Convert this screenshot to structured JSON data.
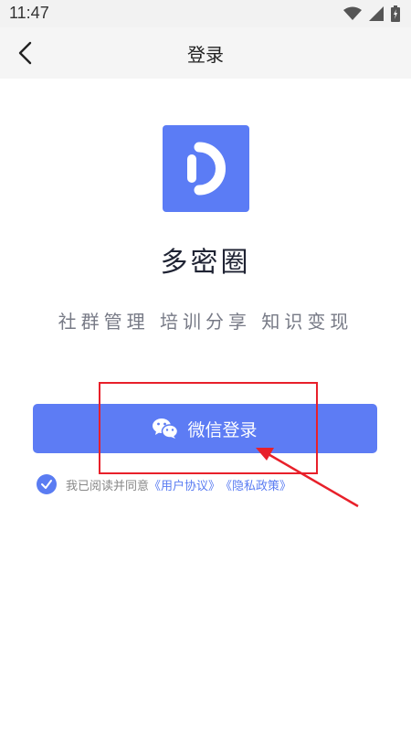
{
  "status_bar": {
    "time": "11:47",
    "icons": [
      "wifi-icon",
      "signal-icon",
      "battery-icon"
    ]
  },
  "nav": {
    "title": "登录",
    "back_icon": "chevron-left-icon"
  },
  "app": {
    "logo_icon": "app-logo",
    "name": "多密圈",
    "slogan": "社群管理 培训分享 知识变现"
  },
  "login": {
    "wechat_label": "微信登录",
    "wechat_icon": "wechat-icon"
  },
  "agreement": {
    "checked": true,
    "prefix": "我已阅读并同意",
    "user_agreement": "《用户协议》",
    "privacy_policy": "《隐私政策》"
  },
  "colors": {
    "primary": "#5d7cf4",
    "annotation": "#e8202a",
    "muted_text": "#888888"
  }
}
